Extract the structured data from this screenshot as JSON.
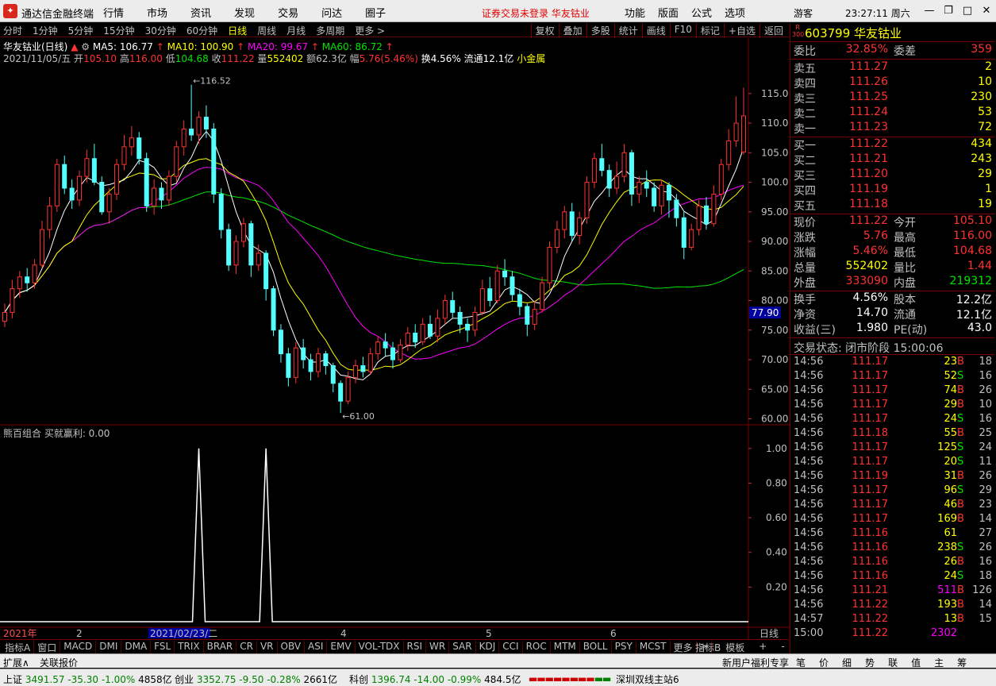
{
  "titlebar": {
    "app_title": "通达信金融终端",
    "menus": [
      "行情",
      "市场",
      "资讯",
      "发现",
      "交易",
      "问达",
      "圈子"
    ],
    "warning": "证券交易未登录  华友钴业",
    "right_menus": [
      "功能",
      "版面",
      "公式",
      "选项"
    ],
    "user": "游客",
    "clock": "23:27:11 周六"
  },
  "toolbar": {
    "periods": [
      "分时",
      "1分钟",
      "5分钟",
      "15分钟",
      "30分钟",
      "60分钟",
      "日线",
      "周线",
      "月线",
      "多周期",
      "更多 >"
    ],
    "active_period": "日线",
    "buttons": [
      "复权",
      "叠加",
      "多股",
      "统计",
      "画线",
      "F10",
      "标记",
      "+自选",
      "返回"
    ]
  },
  "info": {
    "name": "华友钴业(日线)",
    "ma5": "MA5: 106.77",
    "ma10": "MA10: 100.90",
    "ma20": "MA20: 99.67",
    "ma60": "MA60: 86.72",
    "date": "2021/11/05/五",
    "open_label": "开",
    "open": "105.10",
    "high_label": "高",
    "high": "116.00",
    "low_label": "低",
    "low": "104.68",
    "close_label": "收",
    "close": "111.22",
    "vol_label": "量",
    "vol": "552402",
    "amt_label": "额",
    "amt": "62.3亿",
    "chg_label": "幅",
    "chg": "5.76(5.46%)",
    "turn": "换4.56%",
    "float": "流通12.1亿",
    "sector": "小金属"
  },
  "chart_data": [
    {
      "type": "candlestick",
      "title": "华友钴业(日线)",
      "series_names": [
        "MA5",
        "MA10",
        "MA20",
        "MA60"
      ],
      "series_colors": {
        "MA5": "#ffffff",
        "MA10": "#ffff00",
        "MA20": "#ff00ff",
        "MA60": "#00e600"
      },
      "up_color": "#ff3232",
      "down_color": "#54ffff",
      "y_ticks": [
        "115.0",
        "110.0",
        "105.0",
        "100.0",
        "95.00",
        "90.00",
        "85.00",
        "80.00",
        "75.00",
        "70.00",
        "65.00",
        "60.00"
      ],
      "ylim": [
        59,
        119
      ],
      "price_marker": "77.90",
      "annotations": {
        "high": "116.52",
        "low": "61.00"
      },
      "x_ticks": [
        "2021年",
        "2",
        "2021/02/23/二",
        "4",
        "5",
        "6"
      ],
      "x_right_label": "日线",
      "candles": [
        [
          76.5,
          78.0,
          79.5,
          75.5
        ],
        [
          78.0,
          82.0,
          83.5,
          77.0
        ],
        [
          82.0,
          84.0,
          85.0,
          80.5
        ],
        [
          84.0,
          83.0,
          85.5,
          81.5
        ],
        [
          83.0,
          86.0,
          87.0,
          82.0
        ],
        [
          86.0,
          92.0,
          93.5,
          85.5
        ],
        [
          92.0,
          96.0,
          97.5,
          90.5
        ],
        [
          96.0,
          103.0,
          104.0,
          95.0
        ],
        [
          103.0,
          99.0,
          104.5,
          98.0
        ],
        [
          99.0,
          97.0,
          100.5,
          95.5
        ],
        [
          97.0,
          101.0,
          102.0,
          96.0
        ],
        [
          101.0,
          104.0,
          105.5,
          100.0
        ],
        [
          104.0,
          100.0,
          106.5,
          99.5
        ],
        [
          100.0,
          95.0,
          101.0,
          94.5
        ],
        [
          95.0,
          98.0,
          99.0,
          93.0
        ],
        [
          98.0,
          103.0,
          104.0,
          97.0
        ],
        [
          103.0,
          106.0,
          108.0,
          102.0
        ],
        [
          106.0,
          107.5,
          109.5,
          104.5
        ],
        [
          107.5,
          104.0,
          108.5,
          103.0
        ],
        [
          104.0,
          96.0,
          105.0,
          95.0
        ],
        [
          96.0,
          99.0,
          100.5,
          94.5
        ],
        [
          99.0,
          97.0,
          100.0,
          95.5
        ],
        [
          97.0,
          101.0,
          102.0,
          96.0
        ],
        [
          101.0,
          106.0,
          107.0,
          100.0
        ],
        [
          106.0,
          109.0,
          110.5,
          104.5
        ],
        [
          109.0,
          108.0,
          116.5,
          107.0
        ],
        [
          108.0,
          111.0,
          112.0,
          106.5
        ],
        [
          111.0,
          109.0,
          113.0,
          107.5
        ],
        [
          109.0,
          98.0,
          110.0,
          96.5
        ],
        [
          98.0,
          92.0,
          99.0,
          90.5
        ],
        [
          92.0,
          86.0,
          93.0,
          85.0
        ],
        [
          86.0,
          90.0,
          91.0,
          84.5
        ],
        [
          90.0,
          93.0,
          94.0,
          89.0
        ],
        [
          93.0,
          86.0,
          93.5,
          84.0
        ],
        [
          86.0,
          88.0,
          89.5,
          85.0
        ],
        [
          88.0,
          82.0,
          88.5,
          80.0
        ],
        [
          82.0,
          75.0,
          82.5,
          74.0
        ],
        [
          75.0,
          71.0,
          76.0,
          69.5
        ],
        [
          71.0,
          67.0,
          72.0,
          65.5
        ],
        [
          67.0,
          72.0,
          73.0,
          66.0
        ],
        [
          72.0,
          70.0,
          73.5,
          68.5
        ],
        [
          70.0,
          68.0,
          71.0,
          66.5
        ],
        [
          68.0,
          71.0,
          72.0,
          67.0
        ],
        [
          71.0,
          69.0,
          71.5,
          67.5
        ],
        [
          69.0,
          66.0,
          69.5,
          64.5
        ],
        [
          66.0,
          63.0,
          66.5,
          61.0
        ],
        [
          63.0,
          67.0,
          68.0,
          62.5
        ],
        [
          67.0,
          69.0,
          70.0,
          66.0
        ],
        [
          69.0,
          68.0,
          70.5,
          67.0
        ],
        [
          68.0,
          71.0,
          72.0,
          67.5
        ],
        [
          71.0,
          73.0,
          74.0,
          70.0
        ],
        [
          73.0,
          72.0,
          74.5,
          70.5
        ],
        [
          72.0,
          70.0,
          73.0,
          68.5
        ],
        [
          70.0,
          72.5,
          73.5,
          69.5
        ],
        [
          72.5,
          74.5,
          75.5,
          71.5
        ],
        [
          74.5,
          73.0,
          76.0,
          72.0
        ],
        [
          73.0,
          76.0,
          77.0,
          72.5
        ],
        [
          76.0,
          74.0,
          77.5,
          73.5
        ],
        [
          74.0,
          77.0,
          78.5,
          73.0
        ],
        [
          77.0,
          80.0,
          81.0,
          76.0
        ],
        [
          80.0,
          78.0,
          81.5,
          77.0
        ],
        [
          78.0,
          76.0,
          79.0,
          74.5
        ],
        [
          76.0,
          75.0,
          77.0,
          73.0
        ],
        [
          75.0,
          78.0,
          79.0,
          74.0
        ],
        [
          78.0,
          82.0,
          83.5,
          77.5
        ],
        [
          82.0,
          80.0,
          84.0,
          79.0
        ],
        [
          80.0,
          85.0,
          86.0,
          79.5
        ],
        [
          85.0,
          84.0,
          87.0,
          82.5
        ],
        [
          84.0,
          81.0,
          85.0,
          80.0
        ],
        [
          81.0,
          79.0,
          82.0,
          77.5
        ],
        [
          79.0,
          76.0,
          79.5,
          74.0
        ],
        [
          76.0,
          78.5,
          80.0,
          75.0
        ],
        [
          78.5,
          83.0,
          84.0,
          78.0
        ],
        [
          83.0,
          89.0,
          90.0,
          82.0
        ],
        [
          89.0,
          92.0,
          93.5,
          88.0
        ],
        [
          92.0,
          95.0,
          96.0,
          90.5
        ],
        [
          95.0,
          91.0,
          96.5,
          90.0
        ],
        [
          91.0,
          94.0,
          95.0,
          89.5
        ],
        [
          94.0,
          100.0,
          101.0,
          93.0
        ],
        [
          100.0,
          104.0,
          105.0,
          99.0
        ],
        [
          104.0,
          102.0,
          106.5,
          101.0
        ],
        [
          102.0,
          99.0,
          103.0,
          97.5
        ],
        [
          99.0,
          101.0,
          103.5,
          98.0
        ],
        [
          101.0,
          105.0,
          106.5,
          100.0
        ],
        [
          105.0,
          98.0,
          105.5,
          96.0
        ],
        [
          98.0,
          100.0,
          101.0,
          96.5
        ],
        [
          100.0,
          99.0,
          102.0,
          97.5
        ],
        [
          99.0,
          96.0,
          100.0,
          95.0
        ],
        [
          96.0,
          99.5,
          100.5,
          94.5
        ],
        [
          99.5,
          97.0,
          100.0,
          94.0
        ],
        [
          97.0,
          94.0,
          98.0,
          92.5
        ],
        [
          94.0,
          89.0,
          95.0,
          87.0
        ],
        [
          89.0,
          92.0,
          93.0,
          88.5
        ],
        [
          92.0,
          96.0,
          97.0,
          91.0
        ],
        [
          96.0,
          93.0,
          97.5,
          92.0
        ],
        [
          93.0,
          98.0,
          99.5,
          92.5
        ],
        [
          98.0,
          103.0,
          104.0,
          97.0
        ],
        [
          103.0,
          107.0,
          109.0,
          102.0
        ],
        [
          107.0,
          110.0,
          114.5,
          106.0
        ],
        [
          105.1,
          111.22,
          116.0,
          104.68
        ]
      ]
    },
    {
      "type": "line",
      "title": "熊百组合  买就赢利: 0.00",
      "y_ticks": [
        "1.00",
        "0.80",
        "0.60",
        "0.40",
        "0.20"
      ],
      "ylim": [
        0,
        1.1
      ],
      "series": [
        {
          "name": "买就赢利",
          "spikes_at_candle": [
            26,
            35
          ]
        }
      ]
    }
  ],
  "indicator": {
    "label": "熊百组合  买就赢利: 0.00"
  },
  "bottom_tabs": [
    "指标A",
    "窗口",
    "MACD",
    "DMI",
    "DMA",
    "FSL",
    "TRIX",
    "BRAR",
    "CR",
    "VR",
    "OBV",
    "ASI",
    "EMV",
    "VOL-TDX",
    "RSI",
    "WR",
    "SAR",
    "KDJ",
    "CCI",
    "ROC",
    "MTM",
    "BOLL",
    "PSY",
    "MCST",
    "更多",
    ">"
  ],
  "bottom_right": [
    "指标B",
    "模板",
    "+",
    "-"
  ],
  "row2": {
    "left": [
      "扩展∧",
      "关联报价"
    ],
    "promo": "新用户福利专享",
    "tabs": [
      "笔",
      "价",
      "细",
      "势",
      "联",
      "值",
      "主",
      "筹"
    ]
  },
  "quote": {
    "badge": "R\n300",
    "code_name": "603799 华友钴业",
    "webi_label": "委比",
    "webi": "32.85%",
    "weicha_label": "委差",
    "weicha": "359",
    "asks": [
      {
        "label": "卖五",
        "price": "111.27",
        "vol": "2"
      },
      {
        "label": "卖四",
        "price": "111.26",
        "vol": "10"
      },
      {
        "label": "卖三",
        "price": "111.25",
        "vol": "230"
      },
      {
        "label": "卖二",
        "price": "111.24",
        "vol": "53"
      },
      {
        "label": "卖一",
        "price": "111.23",
        "vol": "72"
      }
    ],
    "bids": [
      {
        "label": "买一",
        "price": "111.22",
        "vol": "434"
      },
      {
        "label": "买二",
        "price": "111.21",
        "vol": "243"
      },
      {
        "label": "买三",
        "price": "111.20",
        "vol": "29"
      },
      {
        "label": "买四",
        "price": "111.19",
        "vol": "1"
      },
      {
        "label": "买五",
        "price": "111.18",
        "vol": "19"
      }
    ],
    "stats": [
      {
        "l1": "现价",
        "v1": "111.22",
        "c1": "red",
        "l2": "今开",
        "v2": "105.10",
        "c2": "red"
      },
      {
        "l1": "涨跌",
        "v1": "5.76",
        "c1": "red",
        "l2": "最高",
        "v2": "116.00",
        "c2": "red"
      },
      {
        "l1": "涨幅",
        "v1": "5.46%",
        "c1": "red",
        "l2": "最低",
        "v2": "104.68",
        "c2": "red"
      },
      {
        "l1": "总量",
        "v1": "552402",
        "c1": "yellow",
        "l2": "量比",
        "v2": "1.44",
        "c2": "red"
      },
      {
        "l1": "外盘",
        "v1": "333090",
        "c1": "red",
        "l2": "内盘",
        "v2": "219312",
        "c2": "green"
      }
    ],
    "stats2": [
      {
        "l1": "换手",
        "v1": "4.56%",
        "l2": "股本",
        "v2": "12.2亿"
      },
      {
        "l1": "净资",
        "v1": "14.70",
        "l2": "流通",
        "v2": "12.1亿"
      },
      {
        "l1": "收益(三)",
        "v1": "1.980",
        "l2": "PE(动)",
        "v2": "43.0"
      }
    ],
    "trade_status": "交易状态: 闭市阶段 15:00:06",
    "ticks": [
      {
        "t": "14:56",
        "p": "111.17",
        "v": "23",
        "vc": "yellow",
        "bs": "B",
        "n": "18"
      },
      {
        "t": "14:56",
        "p": "111.17",
        "v": "52",
        "vc": "yellow",
        "bs": "S",
        "n": "16"
      },
      {
        "t": "14:56",
        "p": "111.17",
        "v": "74",
        "vc": "yellow",
        "bs": "B",
        "n": "26"
      },
      {
        "t": "14:56",
        "p": "111.17",
        "v": "29",
        "vc": "yellow",
        "bs": "B",
        "n": "10"
      },
      {
        "t": "14:56",
        "p": "111.17",
        "v": "24",
        "vc": "yellow",
        "bs": "S",
        "n": "16"
      },
      {
        "t": "14:56",
        "p": "111.18",
        "v": "55",
        "vc": "yellow",
        "bs": "B",
        "n": "25"
      },
      {
        "t": "14:56",
        "p": "111.17",
        "v": "125",
        "vc": "yellow",
        "bs": "S",
        "n": "24"
      },
      {
        "t": "14:56",
        "p": "111.17",
        "v": "20",
        "vc": "yellow",
        "bs": "S",
        "n": "11"
      },
      {
        "t": "14:56",
        "p": "111.19",
        "v": "31",
        "vc": "yellow",
        "bs": "B",
        "n": "26"
      },
      {
        "t": "14:56",
        "p": "111.17",
        "v": "96",
        "vc": "yellow",
        "bs": "S",
        "n": "29"
      },
      {
        "t": "14:56",
        "p": "111.17",
        "v": "46",
        "vc": "yellow",
        "bs": "B",
        "n": "23"
      },
      {
        "t": "14:56",
        "p": "111.17",
        "v": "169",
        "vc": "yellow",
        "bs": "B",
        "n": "14"
      },
      {
        "t": "14:56",
        "p": "111.16",
        "v": "61",
        "vc": "yellow",
        "bs": "",
        "n": "27"
      },
      {
        "t": "14:56",
        "p": "111.16",
        "v": "238",
        "vc": "yellow",
        "bs": "S",
        "n": "26"
      },
      {
        "t": "14:56",
        "p": "111.16",
        "v": "26",
        "vc": "yellow",
        "bs": "B",
        "n": "16"
      },
      {
        "t": "14:56",
        "p": "111.16",
        "v": "24",
        "vc": "yellow",
        "bs": "S",
        "n": "18"
      },
      {
        "t": "14:56",
        "p": "111.21",
        "v": "511",
        "vc": "magenta",
        "bs": "B",
        "n": "126"
      },
      {
        "t": "14:56",
        "p": "111.22",
        "v": "193",
        "vc": "yellow",
        "bs": "B",
        "n": "14"
      },
      {
        "t": "14:57",
        "p": "111.22",
        "v": "13",
        "vc": "yellow",
        "bs": "B",
        "n": "15"
      },
      {
        "t": "15:00",
        "p": "111.22",
        "v": "2302",
        "vc": "magenta",
        "bs": "",
        "n": ""
      }
    ]
  },
  "index_bar": {
    "items": [
      {
        "name": "上证",
        "val": "3491.57",
        "chg": "-35.30",
        "pct": "-1.00%",
        "amt": "4858亿"
      },
      {
        "name": "创业",
        "val": "3352.75",
        "chg": "-9.50",
        "pct": "-0.28%",
        "amt": "2661亿"
      },
      {
        "name": "科创",
        "val": "1396.74",
        "chg": "-14.00",
        "pct": "-0.99%",
        "amt": "484.5亿"
      }
    ],
    "server": "深圳双线主站6"
  }
}
